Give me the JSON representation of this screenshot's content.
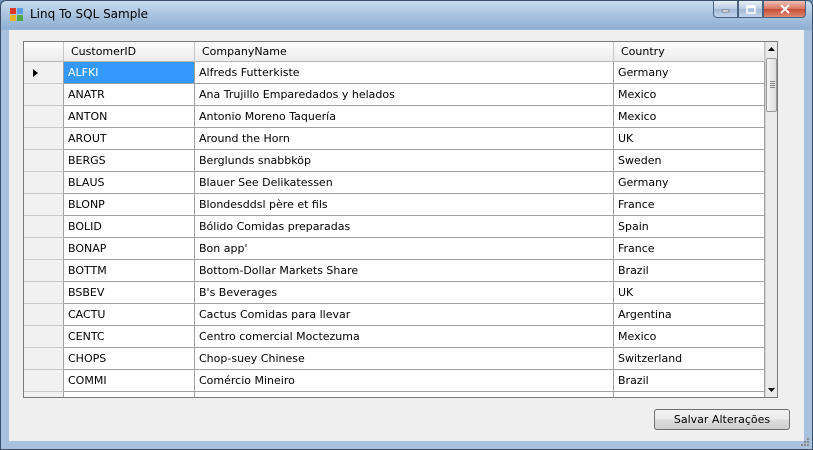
{
  "window": {
    "title": "Linq To SQL Sample"
  },
  "grid": {
    "columns": [
      "CustomerID",
      "CompanyName",
      "Country"
    ],
    "rows": [
      {
        "id": "ALFKI",
        "company": "Alfreds Futterkiste",
        "country": "Germany"
      },
      {
        "id": "ANATR",
        "company": "Ana Trujillo Emparedados y helados",
        "country": "Mexico"
      },
      {
        "id": "ANTON",
        "company": "Antonio Moreno Taquería",
        "country": "Mexico"
      },
      {
        "id": "AROUT",
        "company": "Around the Horn",
        "country": "UK"
      },
      {
        "id": "BERGS",
        "company": "Berglunds snabbköp",
        "country": "Sweden"
      },
      {
        "id": "BLAUS",
        "company": "Blauer See Delikatessen",
        "country": "Germany"
      },
      {
        "id": "BLONP",
        "company": "Blondesddsl père et fils",
        "country": "France"
      },
      {
        "id": "BOLID",
        "company": "Bólido Comidas preparadas",
        "country": "Spain"
      },
      {
        "id": "BONAP",
        "company": "Bon app'",
        "country": "France"
      },
      {
        "id": "BOTTM",
        "company": "Bottom-Dollar Markets Share",
        "country": "Brazil"
      },
      {
        "id": "BSBEV",
        "company": "B's Beverages",
        "country": "UK"
      },
      {
        "id": "CACTU",
        "company": "Cactus Comidas para llevar",
        "country": "Argentina"
      },
      {
        "id": "CENTC",
        "company": "Centro comercial Moctezuma",
        "country": "Mexico"
      },
      {
        "id": "CHOPS",
        "company": "Chop-suey Chinese",
        "country": "Switzerland"
      },
      {
        "id": "COMMI",
        "company": "Comércio Mineiro",
        "country": "Brazil"
      },
      {
        "id": "",
        "company": "",
        "country": ""
      }
    ]
  },
  "buttons": {
    "save": "Salvar Alterações"
  },
  "colors": {
    "selection": "#3399ff",
    "grid_background": "#ababab"
  }
}
